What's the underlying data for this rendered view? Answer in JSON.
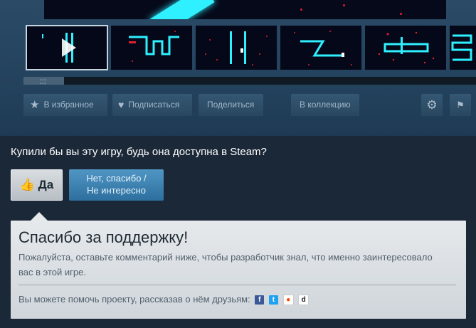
{
  "media": {
    "thumbnails": [
      {
        "kind": "video",
        "label": "video-thumbnail"
      },
      {
        "kind": "screenshot",
        "label": "screenshot-1"
      },
      {
        "kind": "screenshot",
        "label": "screenshot-2"
      },
      {
        "kind": "screenshot",
        "label": "screenshot-3"
      },
      {
        "kind": "screenshot",
        "label": "screenshot-4"
      },
      {
        "kind": "screenshot",
        "label": "screenshot-5"
      }
    ],
    "scroll_position": 0.0
  },
  "actions": {
    "favorite_label": "В избранное",
    "follow_label": "Подписаться",
    "share_label": "Поделиться",
    "collection_label": "В коллекцию",
    "settings_icon": "gear-icon",
    "flag_icon": "flag-icon"
  },
  "vote": {
    "question": "Купили бы вы эту игру, будь она доступна в Steam?",
    "yes_label": "Да",
    "no_label_line1": "Нет, спасибо /",
    "no_label_line2": "Не интересно"
  },
  "thanks": {
    "title": "Спасибо за поддержку!",
    "text": "Пожалуйста, оставьте комментарий ниже, чтобы разработчик знал, что именно заинтересовало вас в этой игре.",
    "share_text": "Вы можете помочь проекту, рассказав о нём друзьям:",
    "share_icons": [
      "facebook-icon",
      "twitter-icon",
      "reddit-icon",
      "digg-icon"
    ]
  },
  "colors": {
    "accent_blue": "#2d6f9e",
    "neon_cyan": "#2ef0ff",
    "page_bg": "#1b2838"
  }
}
